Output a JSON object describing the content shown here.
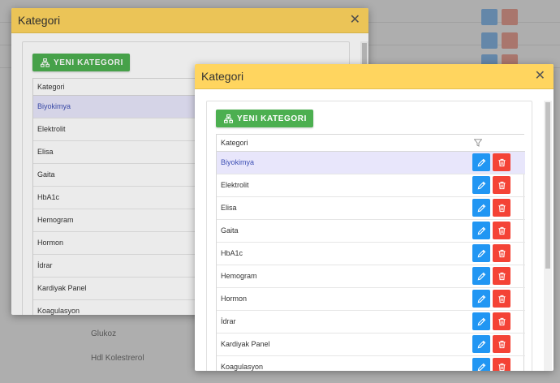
{
  "background": {
    "rows": [
      {
        "col1": "Glukoz"
      },
      {
        "col1": "Hdl Kolestrerol"
      }
    ]
  },
  "back_modal": {
    "title": "Kategori",
    "new_button": "YENI KATEGORI",
    "column_header": "Kategori",
    "items": [
      "Biyokimya",
      "Elektrolit",
      "Elisa",
      "Gaita",
      "HbA1c",
      "Hemogram",
      "Hormon",
      "İdrar",
      "Kardiyak Panel",
      "Koagulasyon"
    ],
    "selected_index": 0
  },
  "front_modal": {
    "title": "Kategori",
    "new_button": "YENI KATEGORI",
    "column_header": "Kategori",
    "items": [
      "Biyokimya",
      "Elektrolit",
      "Elisa",
      "Gaita",
      "HbA1c",
      "Hemogram",
      "Hormon",
      "İdrar",
      "Kardiyak Panel",
      "Koagulasyon"
    ],
    "selected_index": 0
  },
  "colors": {
    "header": "#ffd55f",
    "new_button": "#4caf50",
    "edit": "#2196f3",
    "delete": "#f44336",
    "selected_row": "#e8e6fb"
  },
  "icons": {
    "new": "sitemap-icon",
    "edit": "pencil-icon",
    "delete": "trash-icon",
    "filter": "filter-icon",
    "close": "close-icon"
  }
}
